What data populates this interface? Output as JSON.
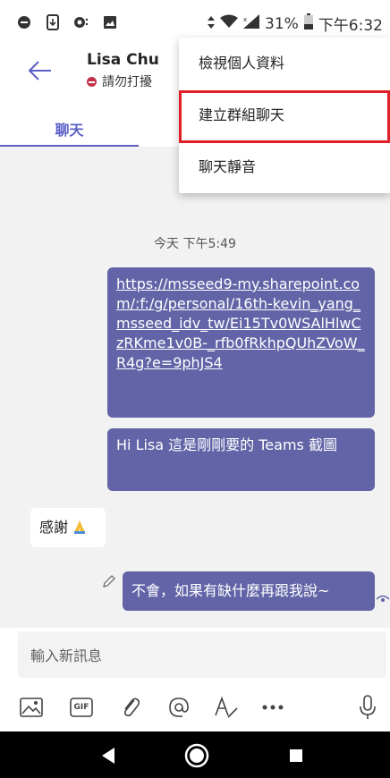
{
  "status_bar": {
    "battery_percent": "31%",
    "time": "下午6:32"
  },
  "contact": {
    "name": "Lisa Chu",
    "presence": "請勿打擾",
    "presence_color": "#c4314b"
  },
  "tabs": [
    {
      "label": "聊天",
      "selected": true
    }
  ],
  "menu": {
    "items": [
      {
        "label": "檢視個人資料"
      },
      {
        "label": "建立群組聊天",
        "highlighted": true
      },
      {
        "label": "聊天靜音"
      }
    ],
    "highlight_color": "#e01f26"
  },
  "messages": {
    "timestamp": "今天 下午5:49",
    "outgoing_link": "https://msseed9-my.sharepoint.com/:f:/g/personal/16th-kevin_yang_msseed_idv_tw/Ei15Tv0WSAlHlwCzRKme1v0B-_rfb0fRkhpQUhZVoW_R4g?e=9phJS4",
    "outgoing_text": "Hi Lisa 這是剛剛要的 Teams 截圖",
    "incoming_text": "感謝",
    "incoming_emoji": "folded-hands-icon",
    "outgoing_reply": "不會，如果有缺什麼再跟我說~"
  },
  "compose": {
    "placeholder": "輸入新訊息"
  },
  "toolbar": {
    "icons": [
      "image-icon",
      "gif-icon",
      "attach-icon",
      "mention-icon",
      "format-icon",
      "more-icon",
      "mic-icon"
    ],
    "gif_label": "GIF"
  },
  "colors": {
    "accent": "#5b5fc7",
    "bubble": "#6264a7",
    "chat_bg": "#f2f2f2"
  }
}
